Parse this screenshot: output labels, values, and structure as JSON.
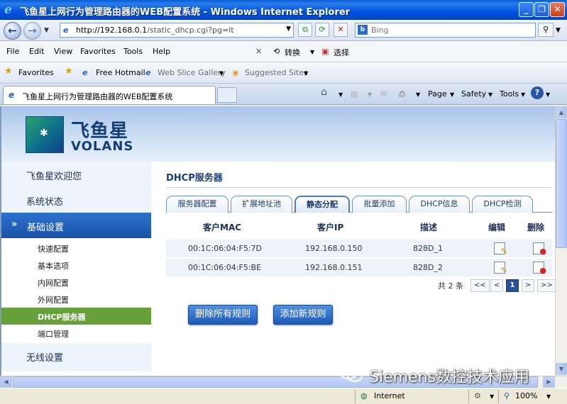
{
  "window": {
    "title": "飞鱼星上网行为管理路由器的WEB配置系统 - Windows Internet Explorer",
    "minimize": "_",
    "maximize": "❐",
    "close": "✕"
  },
  "address_bar": {
    "url_host": "http://192.168.0.1",
    "url_path": "/static_dhcp.cgi?pg=lt",
    "search_placeholder": "Bing"
  },
  "menu": {
    "items": [
      "File",
      "Edit",
      "View",
      "Favorites",
      "Tools",
      "Help"
    ],
    "convert": "转换",
    "select": "选择"
  },
  "favorites_bar": {
    "favorites": "Favorites",
    "hotmail": "Free Hotmail",
    "web_slice": "Web Slice Gallery",
    "suggested": "Suggested Sites"
  },
  "tab": {
    "title": "飞鱼星上网行为管理路由器的WEB配置系统"
  },
  "commandbar": {
    "page": "Page",
    "safety": "Safety",
    "tools": "Tools"
  },
  "header": {
    "logo_cn": "飞鱼星",
    "logo_en": "VOLANS"
  },
  "sidebar": {
    "welcome": "飞鱼星欢迎您",
    "status": "系统状态",
    "basic_section": "基础设置",
    "sub_items": [
      "快速配置",
      "基本选项",
      "内网配置",
      "外网配置",
      "DHCP服务器",
      "端口管理"
    ],
    "wireless": "无线设置"
  },
  "main": {
    "title": "DHCP服务器",
    "tabs": [
      "服务器配置",
      "扩展地址池",
      "静态分配",
      "批量添加",
      "DHCP信息",
      "DHCP检测"
    ],
    "active_tab": "静态分配",
    "table": {
      "headers": [
        "客户MAC",
        "客户IP",
        "描述",
        "编辑",
        "删除"
      ],
      "rows": [
        {
          "mac": "00:1C:06:04:F5:7D",
          "ip": "192.168.0.150",
          "desc": "828D_1"
        },
        {
          "mac": "00:1C:06:04:F5:BE",
          "ip": "192.168.0.151",
          "desc": "828D_2"
        }
      ]
    },
    "pager": {
      "total": "共 2 条",
      "first": "<<",
      "prev": "<",
      "current": "1",
      "next": ">",
      "last": ">>"
    },
    "delete_all": "删除所有规则",
    "add_rule": "添加新规则"
  },
  "statusbar": {
    "zone": "Internet",
    "zoom": "100%"
  },
  "watermark": {
    "text": "Siemens数控技术应用"
  }
}
